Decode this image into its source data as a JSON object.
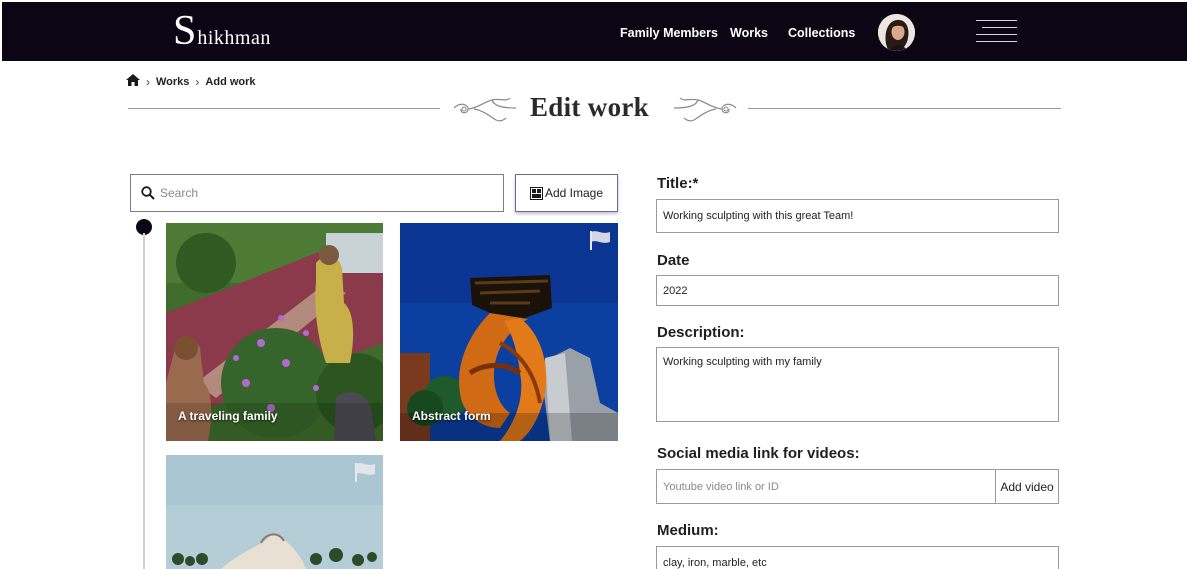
{
  "brand": {
    "logo_initial": "S",
    "logo_rest": "hikhman"
  },
  "nav": {
    "links": [
      "Family Members",
      "Works",
      "Collections"
    ]
  },
  "breadcrumb": {
    "items": [
      "Works",
      "Add work"
    ]
  },
  "page": {
    "title": "Edit work"
  },
  "gallery": {
    "search_placeholder": "Search",
    "add_image_label": "Add Image",
    "tiles": [
      {
        "caption": "A traveling family"
      },
      {
        "caption": "Abstract form"
      },
      {
        "caption": ""
      }
    ]
  },
  "form": {
    "title_label": "Title:*",
    "title_value": "Working sculpting with this great Team!",
    "date_label": "Date",
    "date_value": "2022",
    "description_label": "Description:",
    "description_value": "Working sculpting with my family",
    "social_label": "Social media link for videos:",
    "social_placeholder": "Youtube video link or ID",
    "add_video_label": "Add video",
    "medium_label": "Medium:",
    "medium_value": "clay, iron, marble, etc"
  },
  "colors": {
    "nav_bg": "#0c0614",
    "accent": "#6b6b88"
  }
}
